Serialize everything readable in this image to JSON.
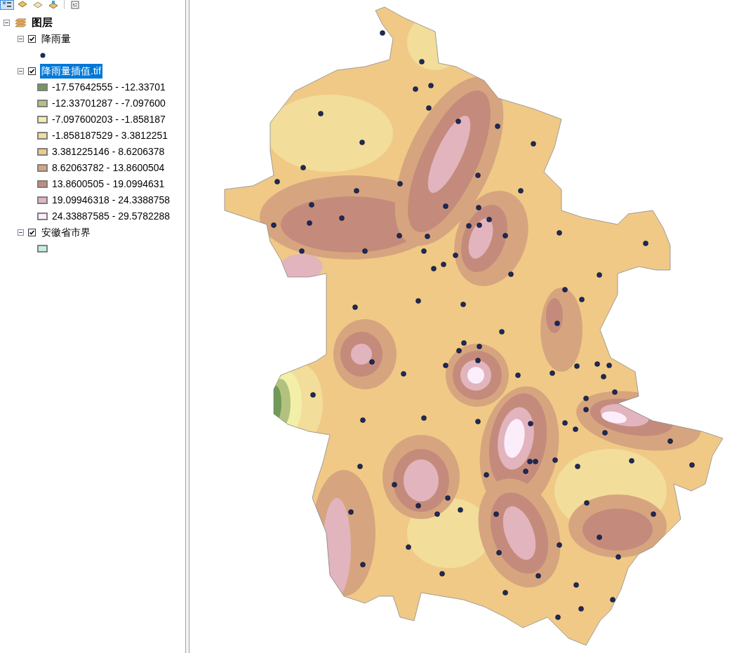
{
  "toc": {
    "root": {
      "label": "图层",
      "expanded": true
    },
    "layers": [
      {
        "name": "降雨量",
        "checked": true,
        "expanded": true,
        "selected": false,
        "legend": [
          {
            "kind": "point",
            "color": "#1f2a5c"
          }
        ]
      },
      {
        "name": "降雨量插值.tif",
        "checked": true,
        "expanded": true,
        "selected": true,
        "legend": [
          {
            "kind": "swatch",
            "color": "#6f9a58",
            "label": "-17.57642555 - -12.33701"
          },
          {
            "kind": "swatch",
            "color": "#b2c27e",
            "label": "-12.33701287 - -7.097600"
          },
          {
            "kind": "swatch",
            "color": "#f2f0a8",
            "label": "-7.097600203 - -1.858187"
          },
          {
            "kind": "swatch",
            "color": "#f2dd9a",
            "label": "-1.858187529 - 3.3812251"
          },
          {
            "kind": "swatch",
            "color": "#f0c987",
            "label": "3.381225146 - 8.6206378"
          },
          {
            "kind": "swatch",
            "color": "#d6a57f",
            "label": "8.62063782 - 13.8600504"
          },
          {
            "kind": "swatch",
            "color": "#c48b7c",
            "label": "13.8600505 - 19.0994631"
          },
          {
            "kind": "swatch",
            "color": "#e2b4bd",
            "label": "19.09946318 - 24.3388758"
          },
          {
            "kind": "swatch",
            "color": "#fbeefa",
            "label": "24.33887585 - 29.5782288"
          }
        ]
      },
      {
        "name": "安徽省市界",
        "checked": true,
        "expanded": true,
        "selected": false,
        "legend": [
          {
            "kind": "swatch",
            "color": "#c4efe6"
          }
        ]
      }
    ]
  }
}
